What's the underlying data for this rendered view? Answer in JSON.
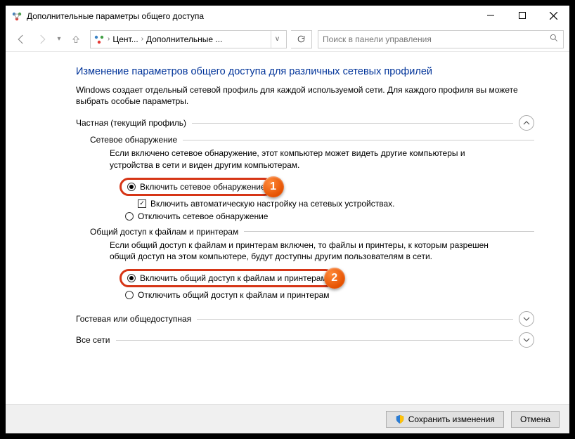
{
  "window": {
    "title": "Дополнительные параметры общего доступа"
  },
  "breadcrumb": {
    "crumb1": "Цент...",
    "crumb2": "Дополнительные ..."
  },
  "search": {
    "placeholder": "Поиск в панели управления"
  },
  "page": {
    "heading": "Изменение параметров общего доступа для различных сетевых профилей",
    "intro": "Windows создает отдельный сетевой профиль для каждой используемой сети. Для каждого профиля вы можете выбрать особые параметры."
  },
  "private": {
    "title": "Частная (текущий профиль)",
    "discovery": {
      "title": "Сетевое обнаружение",
      "desc": "Если включено сетевое обнаружение, этот компьютер может видеть другие компьютеры и устройства в сети и виден другим компьютерам.",
      "opt_on": "Включить сетевое обнаружение",
      "opt_auto": "Включить автоматическую настройку на сетевых устройствах.",
      "opt_off": "Отключить сетевое обнаружение"
    },
    "sharing": {
      "title": "Общий доступ к файлам и принтерам",
      "desc": "Если общий доступ к файлам и принтерам включен, то файлы и принтеры, к которым разрешен общий доступ на этом компьютере, будут доступны другим пользователям в сети.",
      "opt_on": "Включить общий доступ к файлам и принтерам",
      "opt_off": "Отключить общий доступ к файлам и принтерам"
    }
  },
  "guest": {
    "title": "Гостевая или общедоступная"
  },
  "all": {
    "title": "Все сети"
  },
  "footer": {
    "save": "Сохранить изменения",
    "cancel": "Отмена"
  },
  "badges": {
    "b1": "1",
    "b2": "2"
  }
}
